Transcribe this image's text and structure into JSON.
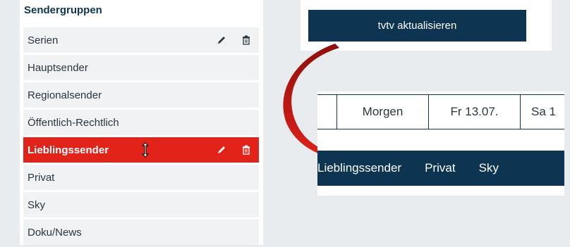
{
  "sidebar": {
    "title": "Sendergruppen",
    "items": [
      {
        "label": "Serien",
        "has_actions": true,
        "active": false
      },
      {
        "label": "Hauptsender",
        "has_actions": false,
        "active": false
      },
      {
        "label": "Regionalsender",
        "has_actions": false,
        "active": false
      },
      {
        "label": "Öffentlich-Rechtlich",
        "has_actions": false,
        "active": false
      },
      {
        "label": "Lieblingssender",
        "has_actions": true,
        "active": true
      },
      {
        "label": "Privat",
        "has_actions": false,
        "active": false
      },
      {
        "label": "Sky",
        "has_actions": false,
        "active": false
      },
      {
        "label": "Doku/News",
        "has_actions": false,
        "active": false
      }
    ]
  },
  "update": {
    "button_label": "tvtv aktualisieren"
  },
  "date_tabs": [
    "Morgen",
    "Fr 13.07.",
    "Sa 1"
  ],
  "group_nav": [
    "Lieblingssender",
    "Privat",
    "Sky"
  ],
  "colors": {
    "navy": "#0d3552",
    "red": "#e2231a",
    "arrow_red": "#cc1e18",
    "item_bg": "#f0f2f4"
  },
  "icons": {
    "edit": "pencil-icon",
    "delete": "trash-icon",
    "cursor": "resize-cursor-icon",
    "arrow": "curved-arrow-icon"
  }
}
